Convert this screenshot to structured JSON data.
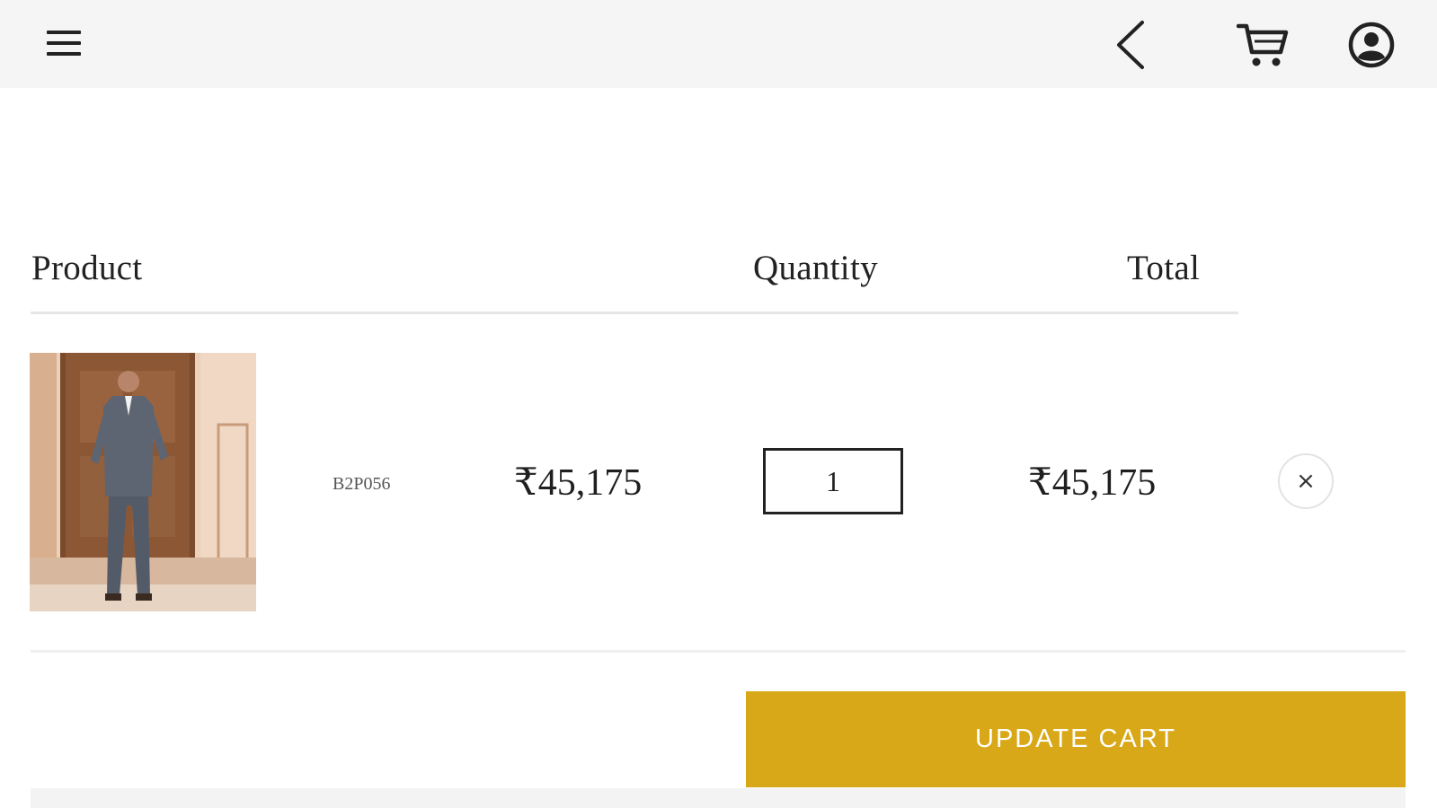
{
  "header": {
    "menu_icon": "hamburger-menu-icon",
    "back_icon": "chevron-left-icon",
    "cart_icon": "shopping-cart-icon",
    "account_icon": "user-circle-icon"
  },
  "cart_table": {
    "columns": {
      "product": "Product",
      "quantity": "Quantity",
      "total": "Total"
    },
    "items": [
      {
        "sku": "B2P056",
        "price": "₹45,175",
        "quantity": "1",
        "total": "₹45,175",
        "remove_symbol": "×"
      }
    ]
  },
  "actions": {
    "update_cart_label": "UPDATE CART"
  },
  "colors": {
    "accent": "#d8a818",
    "header_bg": "#f5f5f5"
  }
}
